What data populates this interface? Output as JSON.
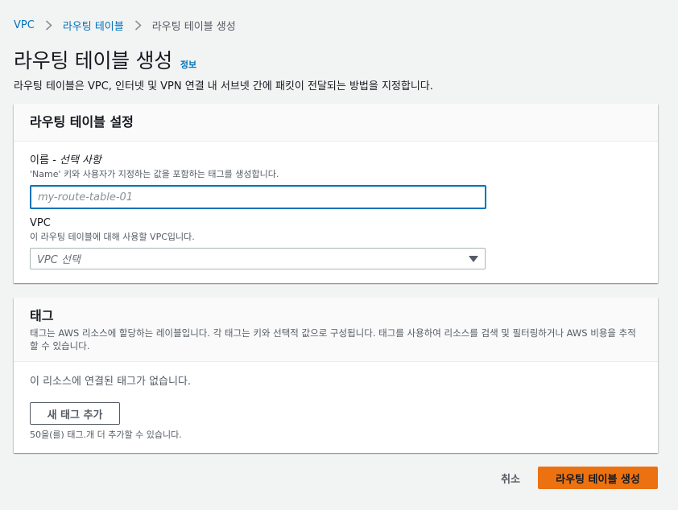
{
  "breadcrumb": {
    "items": [
      "VPC",
      "라우팅 테이블",
      "라우팅 테이블 생성"
    ]
  },
  "header": {
    "title": "라우팅 테이블 생성",
    "info": "정보",
    "description": "라우팅 테이블은 VPC, 인터넷 및 VPN 연결 내 서브넷 간에 패킷이 전달되는 방법을 지정합니다."
  },
  "settings": {
    "title": "라우팅 테이블 설정",
    "name_label": "이름",
    "name_optional": "선택 사항",
    "name_hint": "'Name' 키와 사용자가 지정하는 값을 포함하는 태그를 생성합니다.",
    "name_placeholder": "my-route-table-01",
    "vpc_label": "VPC",
    "vpc_hint": "이 라우팅 테이블에 대해 사용할 VPC입니다.",
    "vpc_select_value": "VPC 선택"
  },
  "tags": {
    "title": "태그",
    "description": "태그는 AWS 리소스에 할당하는 레이블입니다. 각 태그는 키와 선택적 값으로 구성됩니다. 태그를 사용하여 리소스를 검색 및 필터링하거나 AWS 비용을 추적할 수 있습니다.",
    "empty": "이 리소스에 연결된 태그가 없습니다.",
    "add_button": "새 태그 추가",
    "limit": "50을(를) 태그.개 더 추가할 수 있습니다."
  },
  "actions": {
    "cancel": "취소",
    "create": "라우팅 테이블 생성"
  },
  "colors": {
    "link": "#0073bb",
    "primary": "#ec7211",
    "background": "#f2f3f3"
  },
  "icons": {
    "separator": "chevron-right-icon",
    "dropdown": "caret-down-icon"
  }
}
